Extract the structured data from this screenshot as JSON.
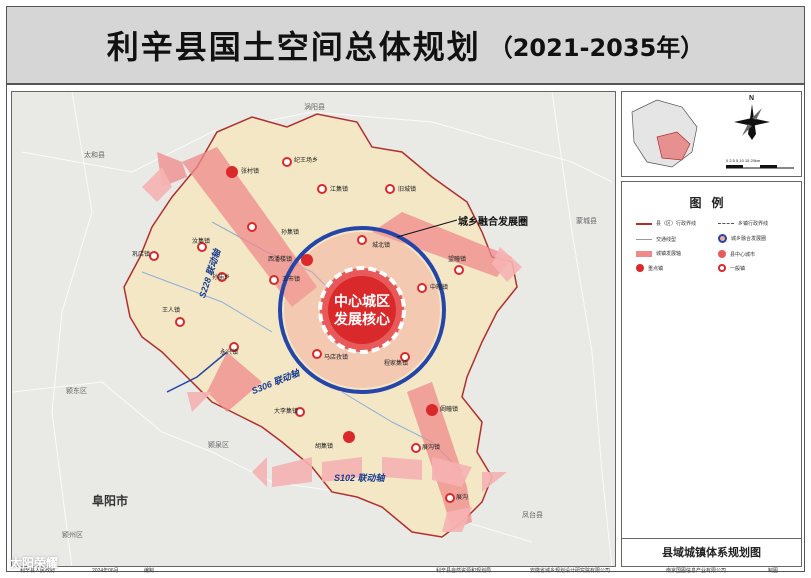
{
  "title": {
    "main": "利辛县国土空间总体规划",
    "period": "（2021-2035年）"
  },
  "map": {
    "callout": "城乡融合发展圈",
    "core_label": [
      "中心城区",
      "发展核心"
    ],
    "axes": {
      "s228": "S228 联动轴",
      "s306": "S306 联动轴",
      "s102": "S102 联动轴"
    },
    "neighbors": {
      "guoyang": "涡阳县",
      "taihe": "太和县",
      "mengcheng": "蒙城县",
      "yingdong": "颍东区",
      "yingquan": "颍泉区",
      "yingzhou": "颍州区",
      "fengtai": "凤台县",
      "fuyang": "阜阳市"
    },
    "key_towns": [
      "张村镇",
      "西潘楼镇",
      "阚疃镇",
      "胡集镇"
    ],
    "towns": [
      "城北镇",
      "中疃镇",
      "望疃镇",
      "程家集镇",
      "马店孜镇",
      "永兴镇",
      "王人镇",
      "巩店镇",
      "孙集镇",
      "汝集镇",
      "王市镇",
      "江集镇",
      "纪王场乡",
      "旧城镇",
      "孙庙乡",
      "大李集镇",
      "展沟镇",
      "展沟",
      "张村"
    ]
  },
  "legend": {
    "title": "图例",
    "items": [
      "县（区）行政界线",
      "乡镇行政界线",
      "交通线型",
      "城乡融合发展圈",
      "城镇发展轴",
      "县中心城市",
      "重点镇",
      "一般镇"
    ],
    "plan_name": "县域城镇体系规划图"
  },
  "inset": {
    "north": "N",
    "scale": "0  2.5 5  10  15  20km"
  },
  "footer": {
    "left": "利辛县人民政府",
    "date": "2024年06月",
    "made": "编制",
    "org1": "利辛县自然资源和规划局",
    "org2": "安徽省城乡规划设计研究院有限公司",
    "org3": "南京国图信息产业有限公司",
    "made2": "制图"
  },
  "watermark": "太阳荣耀",
  "colors": {
    "county_fill": "#f3e7c6",
    "axis": "#f08a8a",
    "ring": "#2545a8",
    "core": "#e85a5a",
    "town_red": "#d9292b"
  }
}
